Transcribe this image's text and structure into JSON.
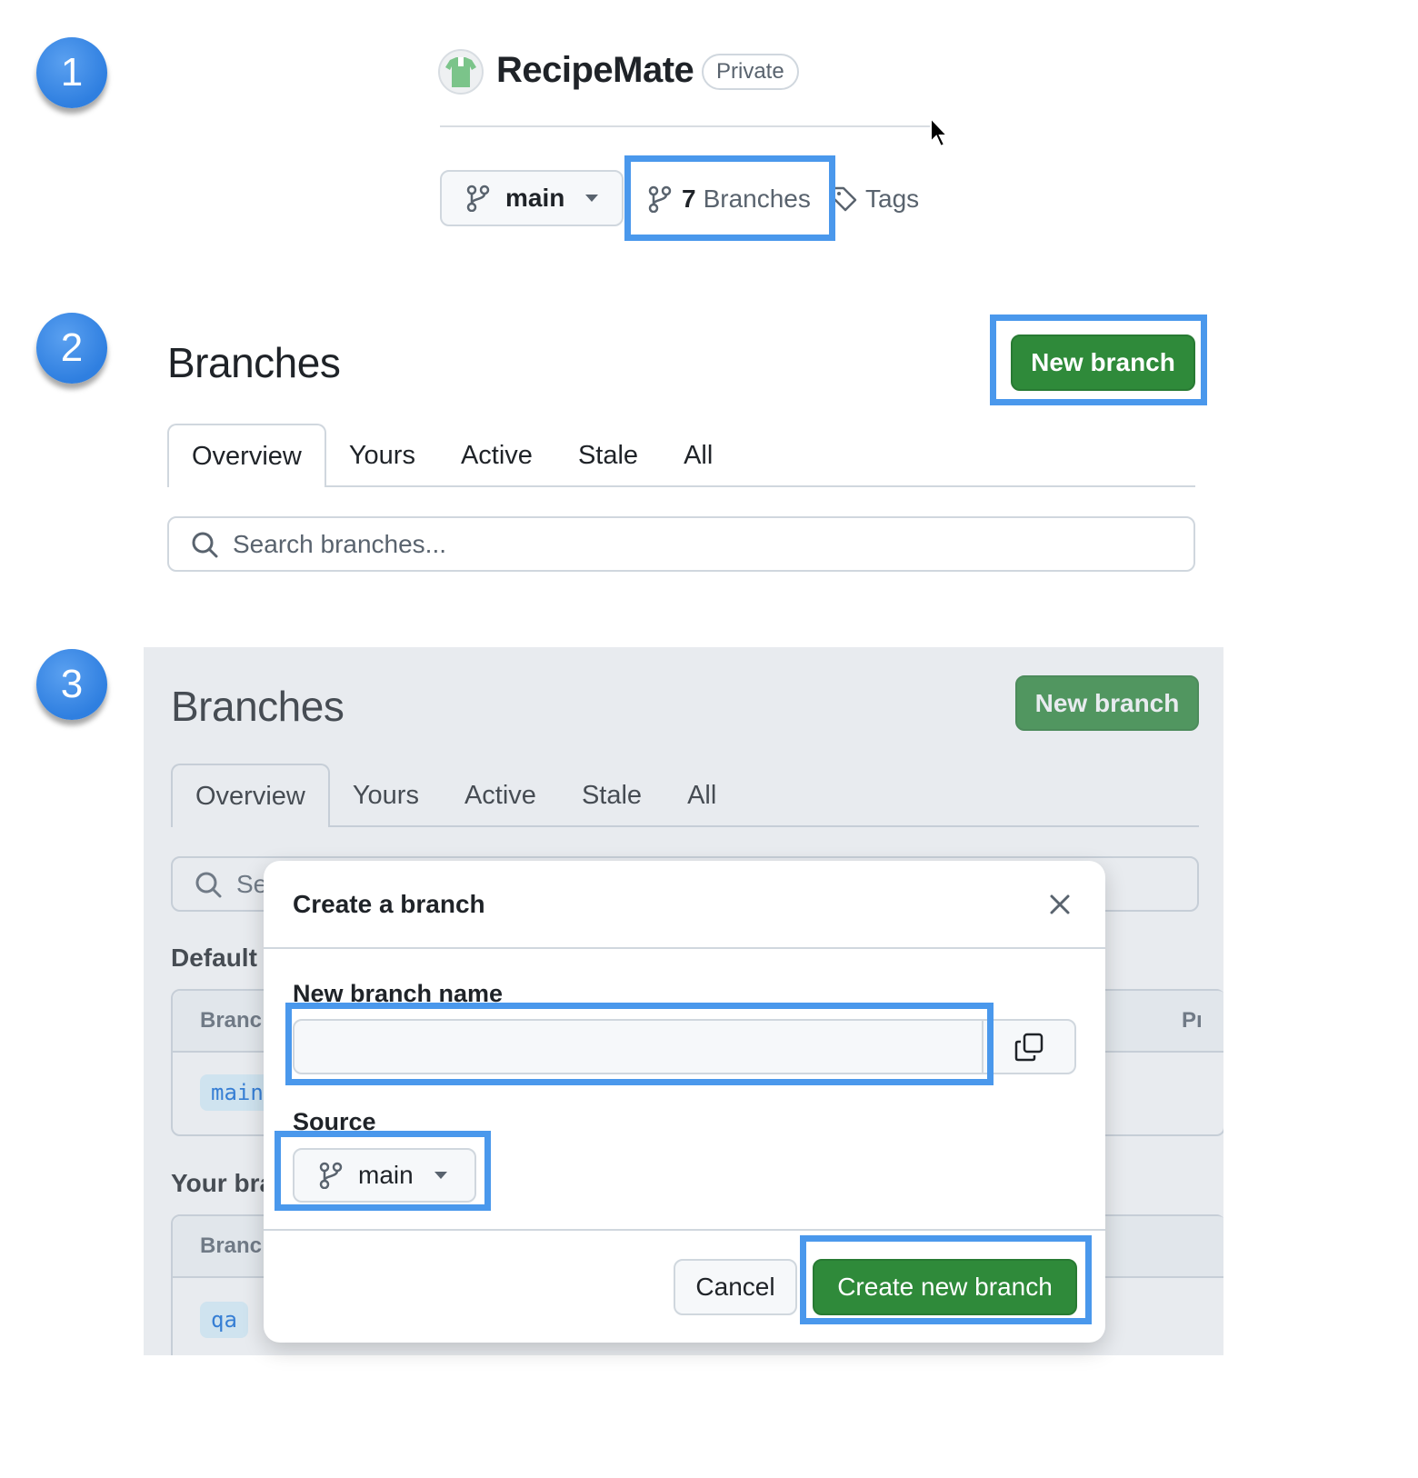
{
  "steps": [
    "1",
    "2",
    "3"
  ],
  "repo": {
    "name": "RecipeMate",
    "visibility": "Private",
    "branch_selector": "main",
    "branches_count": "7",
    "branches_label": "Branches",
    "tags_label": "Tags"
  },
  "branches_page": {
    "title": "Branches",
    "new_branch_button": "New branch",
    "tabs": [
      "Overview",
      "Yours",
      "Active",
      "Stale",
      "All"
    ],
    "search_placeholder": "Search branches..."
  },
  "background_page": {
    "title": "Branches",
    "new_branch_button": "New branch",
    "tabs": [
      "Overview",
      "Yours",
      "Active",
      "Stale",
      "All"
    ],
    "search_partial": "Se",
    "default_heading": "Default",
    "default_col_header": "Branc",
    "default_branch": "main",
    "right_col_header": "Pı",
    "your_heading": "Your bra",
    "your_col_header": "Branc",
    "your_branch": "qa"
  },
  "dialog": {
    "title": "Create a branch",
    "name_label": "New branch name",
    "name_value": "",
    "source_label": "Source",
    "source_value": "main",
    "cancel": "Cancel",
    "create": "Create new branch"
  },
  "colors": {
    "highlight": "#4a98ec",
    "primary_green": "#2f8a3a",
    "step_badge": "#2f7fe0"
  }
}
